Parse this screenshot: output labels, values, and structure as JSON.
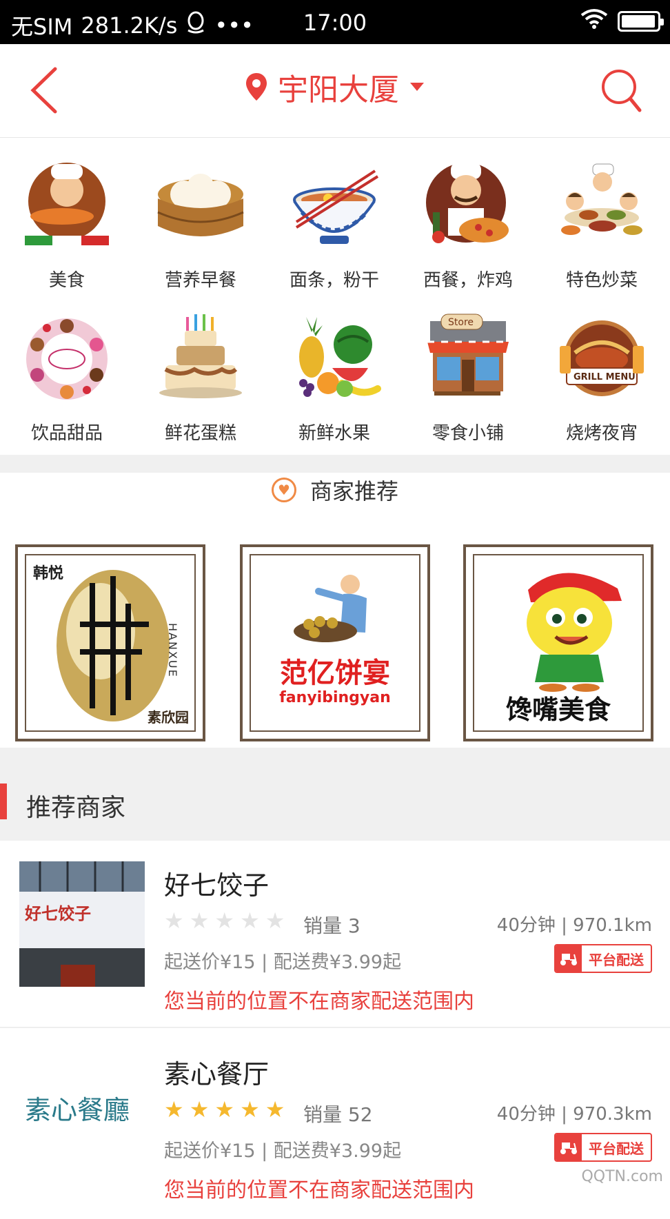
{
  "status_bar": {
    "carrier": "无SIM",
    "net_speed": "281.2K/s",
    "dots": "•••",
    "time": "17:00",
    "battery_level": 0.95
  },
  "header": {
    "location": "宇阳大厦"
  },
  "categories": [
    {
      "label": "美食",
      "icon": "chef-pizza-icon"
    },
    {
      "label": "营养早餐",
      "icon": "steamed-buns-icon"
    },
    {
      "label": "面条，粉干",
      "icon": "noodle-bowl-icon"
    },
    {
      "label": "西餐，炸鸡",
      "icon": "chef-western-icon"
    },
    {
      "label": "特色炒菜",
      "icon": "cooking-family-icon"
    },
    {
      "label": "饮品甜品",
      "icon": "dessert-ring-icon"
    },
    {
      "label": "鲜花蛋糕",
      "icon": "birthday-cake-icon"
    },
    {
      "label": "新鲜水果",
      "icon": "fruits-icon"
    },
    {
      "label": "零食小铺",
      "icon": "store-icon"
    },
    {
      "label": "烧烤夜宵",
      "icon": "grill-menu-icon"
    }
  ],
  "featured": {
    "title": "商家推荐",
    "banners": [
      {
        "cn": "韩悦",
        "en": "HANXUE",
        "sub": "素欣园"
      },
      {
        "cn": "范亿饼宴",
        "en": "fanyibingyan"
      },
      {
        "cn": "馋嘴美食"
      }
    ]
  },
  "section_title": "推荐商家",
  "stores": [
    {
      "name": "好七饺子",
      "rating": 0,
      "sales": "销量 3",
      "eta": "40分钟 | 970.1km",
      "fees": "起送价¥15 | 配送费¥3.99起",
      "delivery_badge": "平台配送",
      "notice": "您当前的位置不在商家配送范围内",
      "sign": "好七饺子"
    },
    {
      "name": "素心餐厅",
      "rating": 5,
      "sales": "销量 52",
      "eta": "40分钟 | 970.3km",
      "fees": "起送价¥15 | 配送费¥3.99起",
      "delivery_badge": "平台配送",
      "notice": "您当前的位置不在商家配送范围内",
      "sign": "素心餐廳"
    }
  ],
  "colors": {
    "accent": "#e8413d",
    "star_on": "#f5b82e",
    "star_off": "#e3e3e3"
  },
  "watermark": "QQTN.com"
}
